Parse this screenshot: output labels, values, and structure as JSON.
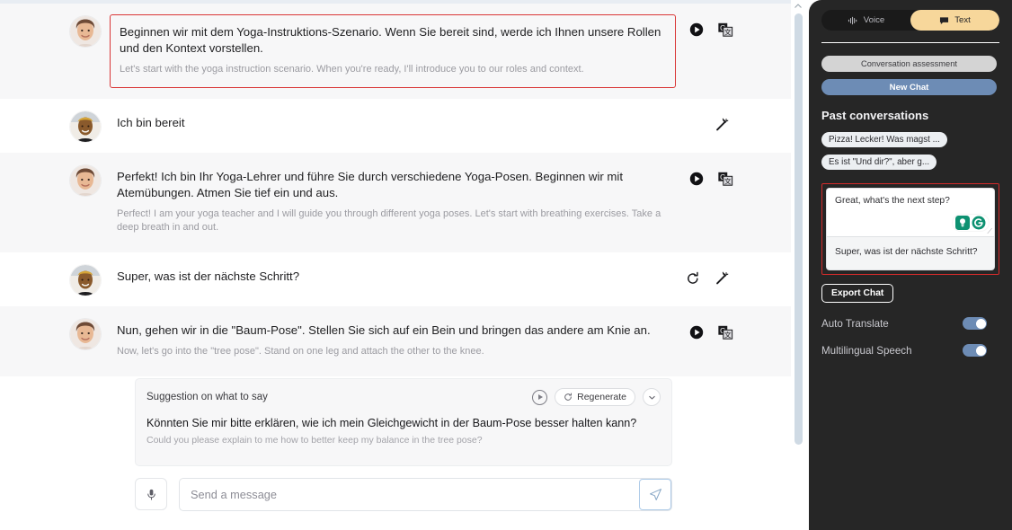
{
  "chat": {
    "messages": [
      {
        "role": "assistant",
        "avatar": "teacher-avatar",
        "text": "Beginnen wir mit dem Yoga-Instruktions-Szenario. Wenn Sie bereit sind, werde ich Ihnen unsere Rollen und den Kontext vorstellen.",
        "translation": "Let's start with the yoga instruction scenario. When you're ready, I'll introduce you to our roles and context.",
        "highlighted": true,
        "actions": [
          "play-icon",
          "translate-icon"
        ]
      },
      {
        "role": "user",
        "avatar": "learner-avatar",
        "text": "Ich bin bereit",
        "translation": "",
        "highlighted": false,
        "actions": [
          "magic-wand-icon"
        ]
      },
      {
        "role": "assistant",
        "avatar": "teacher-avatar",
        "text": "Perfekt! Ich bin Ihr Yoga-Lehrer und führe Sie durch verschiedene Yoga-Posen. Beginnen wir mit Atemübungen. Atmen Sie tief ein und aus.",
        "translation": "Perfect! I am your yoga teacher and I will guide you through different yoga poses. Let's start with breathing exercises. Take a deep breath in and out.",
        "highlighted": false,
        "actions": [
          "play-icon",
          "translate-icon"
        ]
      },
      {
        "role": "user",
        "avatar": "learner-avatar",
        "text": "Super, was ist der nächste Schritt?",
        "translation": "",
        "highlighted": false,
        "actions": [
          "regenerate-icon",
          "magic-wand-icon"
        ]
      },
      {
        "role": "assistant",
        "avatar": "teacher-avatar",
        "text": "Nun, gehen wir in die \"Baum-Pose\". Stellen Sie sich auf ein Bein und bringen das andere am Knie an.",
        "translation": "Now, let's go into the \"tree pose\". Stand on one leg and attach the other to the knee.",
        "highlighted": false,
        "actions": [
          "play-icon",
          "translate-icon"
        ]
      }
    ]
  },
  "suggestion": {
    "label": "Suggestion on what to say",
    "regenerate_label": "Regenerate",
    "text": "Könnten Sie mir bitte erklären, wie ich mein Gleichgewicht in der Baum-Pose besser halten kann?",
    "translation": "Could you please explain to me how to better keep my balance in the tree pose?"
  },
  "composer": {
    "placeholder": "Send a message",
    "value": "",
    "mic_icon": "microphone-icon",
    "send_icon": "send-icon"
  },
  "sidebar": {
    "mode_toggle": {
      "voice_label": "Voice",
      "text_label": "Text",
      "active": "Text"
    },
    "assessment_label": "Conversation assessment",
    "new_chat_label": "New Chat",
    "past_conversations_title": "Past conversations",
    "past_conversations": [
      "Pizza! Lecker! Was magst ...",
      "Es ist \"Und dir?\", aber g..."
    ],
    "edit_panel": {
      "english_text": "Great, what's the next step?",
      "translated_text": "Super, was ist der nächste Schritt?",
      "grammarly_icons": [
        "lightbulb-icon",
        "grammarly-g-icon"
      ]
    },
    "export_label": "Export Chat",
    "toggles": [
      {
        "label": "Auto Translate",
        "on": true
      },
      {
        "label": "Multilingual Speech",
        "on": true
      }
    ]
  },
  "colors": {
    "sidebar_bg": "#262626",
    "accent_blue": "#6d8cb5",
    "accent_amber": "#f7d79b",
    "highlight_red": "#d42b2b",
    "grammarly_green": "#15a37f",
    "assistant_row_bg": "#f7f7f8"
  }
}
